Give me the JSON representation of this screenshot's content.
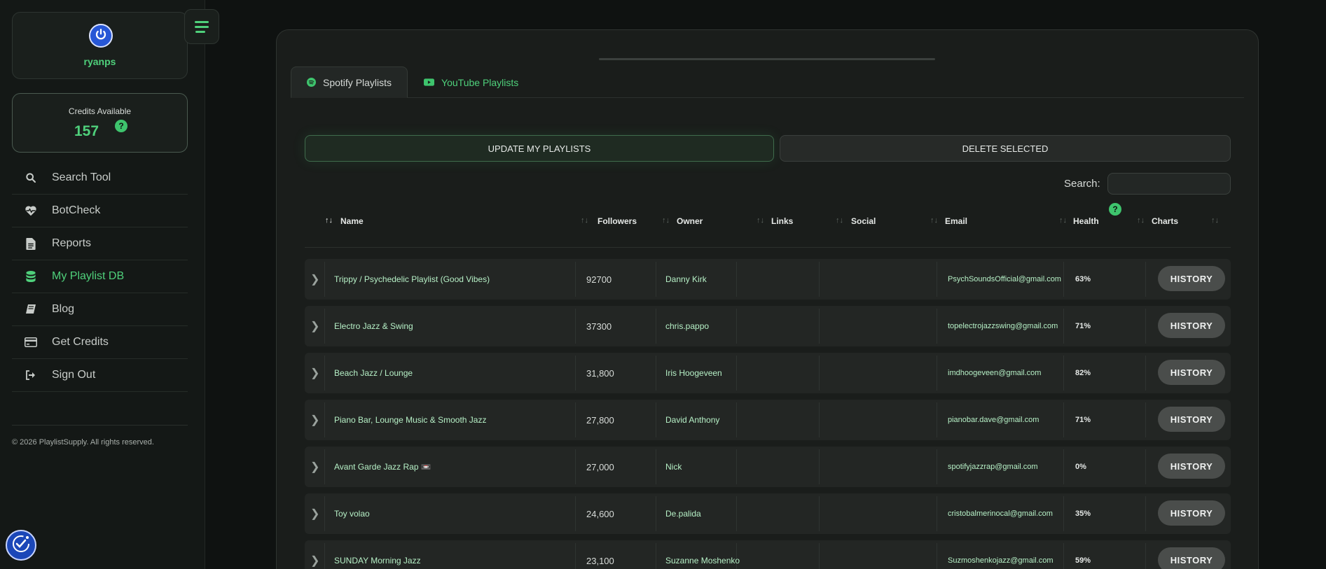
{
  "user": {
    "name": "ryanps"
  },
  "credits": {
    "label": "Credits Available",
    "value": "157",
    "help": "?"
  },
  "nav": {
    "items": [
      {
        "label": "Search Tool",
        "icon": "search-icon",
        "active": false
      },
      {
        "label": "BotCheck",
        "icon": "heart-pulse-icon",
        "active": false
      },
      {
        "label": "Reports",
        "icon": "document-icon",
        "active": false
      },
      {
        "label": "My Playlist DB",
        "icon": "database-icon",
        "active": true
      },
      {
        "label": "Blog",
        "icon": "book-icon",
        "active": false
      },
      {
        "label": "Get Credits",
        "icon": "credit-card-icon",
        "active": false
      },
      {
        "label": "Sign Out",
        "icon": "sign-out-icon",
        "active": false
      }
    ]
  },
  "footer": {
    "copyright": "© 2026 PlaylistSupply. All rights reserved."
  },
  "tabs": [
    {
      "label": "Spotify Playlists",
      "icon": "spotify-icon",
      "active": true
    },
    {
      "label": "YouTube Playlists",
      "icon": "youtube-icon",
      "active": false
    }
  ],
  "actions": {
    "update": "UPDATE MY PLAYLISTS",
    "delete": "DELETE SELECTED"
  },
  "search": {
    "label": "Search:",
    "value": "",
    "placeholder": ""
  },
  "table": {
    "columns": [
      "Name",
      "Followers",
      "Owner",
      "Links",
      "Social",
      "Email",
      "Health",
      "Charts"
    ],
    "health_help": "?",
    "history_label": "HISTORY",
    "rows": [
      {
        "name": "Trippy / Psychedelic Playlist (Good Vibes)",
        "followers": "92700",
        "owner": "Danny Kirk",
        "links": "",
        "social": "",
        "email": "PsychSoundsOfficial@gmail.com",
        "health": "63%"
      },
      {
        "name": "Electro Jazz & Swing",
        "followers": "37300",
        "owner": "chris.pappo",
        "links": "",
        "social": "",
        "email": "topelectrojazzswing@gmail.com",
        "health": "71%"
      },
      {
        "name": "Beach Jazz / Lounge",
        "followers": "31,800",
        "owner": "Iris Hoogeveen",
        "links": "",
        "social": "",
        "email": "imdhoogeveen@gmail.com",
        "health": "82%"
      },
      {
        "name": "Piano Bar, Lounge Music & Smooth Jazz",
        "followers": "27,800",
        "owner": "David Anthony",
        "links": "",
        "social": "",
        "email": "pianobar.dave@gmail.com",
        "health": "71%"
      },
      {
        "name": "Avant Garde Jazz Rap 📼",
        "followers": "27,000",
        "owner": "Nick",
        "links": "",
        "social": "",
        "email": "spotifyjazzrap@gmail.com",
        "health": "0%"
      },
      {
        "name": "Toy volao",
        "followers": "24,600",
        "owner": "De.palida",
        "links": "",
        "social": "",
        "email": "cristobalmerinocal@gmail.com",
        "health": "35%"
      },
      {
        "name": "SUNDAY Morning Jazz",
        "followers": "23,100",
        "owner": "Suzanne Moshenko",
        "links": "",
        "social": "",
        "email": "Suzmoshenkojazz@gmail.com",
        "health": "59%"
      }
    ]
  }
}
